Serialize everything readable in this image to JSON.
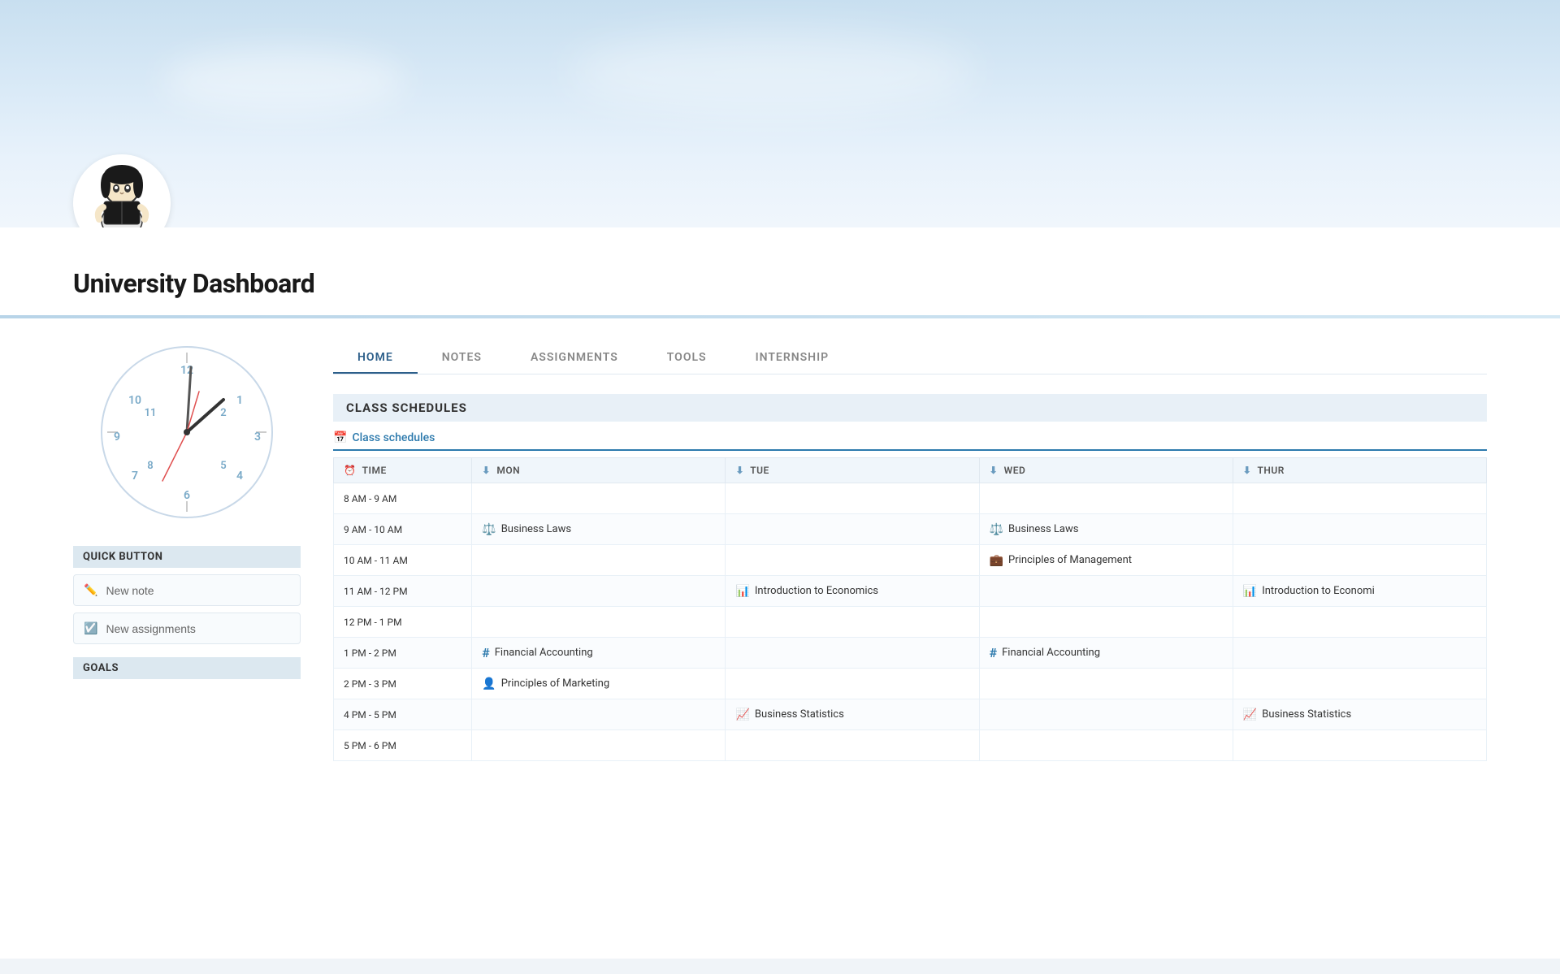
{
  "hero": {
    "title": "University Dashboard"
  },
  "sidebar": {
    "quick_button_label": "QUICK BUTTON",
    "new_note_label": "New note",
    "new_assignments_label": "New assignments",
    "goals_label": "GOALS"
  },
  "nav": {
    "tabs": [
      {
        "id": "home",
        "label": "HOME",
        "active": true
      },
      {
        "id": "notes",
        "label": "NOTES",
        "active": false
      },
      {
        "id": "assignments",
        "label": "ASSIGNMENTS",
        "active": false
      },
      {
        "id": "tools",
        "label": "TOOLS",
        "active": false
      },
      {
        "id": "internship",
        "label": "INTERNSHIP",
        "active": false
      }
    ]
  },
  "schedule": {
    "section_title": "CLASS SCHEDULES",
    "tab_label": "Class schedules",
    "columns": {
      "time": "TIME",
      "mon": "MON",
      "tue": "TUE",
      "wed": "WED",
      "thur": "THUR"
    },
    "rows": [
      {
        "time": "8 AM - 9 AM",
        "mon": null,
        "tue": null,
        "wed": null,
        "thur": null
      },
      {
        "time": "9 AM - 10 AM",
        "mon": {
          "icon": "⚖️",
          "text": "Business Laws",
          "icon_class": "icon-blue"
        },
        "tue": null,
        "wed": {
          "icon": "⚖️",
          "text": "Business Laws",
          "icon_class": "icon-blue"
        },
        "thur": null
      },
      {
        "time": "10 AM - 11 AM",
        "mon": null,
        "tue": null,
        "wed": {
          "icon": "💼",
          "text": "Principles of Management",
          "icon_class": "icon-blue"
        },
        "thur": null
      },
      {
        "time": "11 AM - 12 PM",
        "mon": null,
        "tue": {
          "icon": "📊",
          "text": "Introduction to Economics",
          "icon_class": "icon-blue"
        },
        "wed": null,
        "thur": {
          "icon": "📊",
          "text": "Introduction to Economi",
          "icon_class": "icon-blue"
        }
      },
      {
        "time": "12 PM - 1 PM",
        "mon": null,
        "tue": null,
        "wed": null,
        "thur": null
      },
      {
        "time": "1 PM - 2 PM",
        "mon": {
          "icon": "#",
          "text": "Financial Accounting",
          "icon_class": "icon-blue"
        },
        "tue": null,
        "wed": {
          "icon": "#",
          "text": "Financial Accounting",
          "icon_class": "icon-blue"
        },
        "thur": null
      },
      {
        "time": "2 PM - 3 PM",
        "mon": {
          "icon": "👤",
          "text": "Principles of Marketing",
          "icon_class": "icon-blue"
        },
        "tue": null,
        "wed": null,
        "thur": null
      },
      {
        "time": "4 PM - 5 PM",
        "mon": null,
        "tue": {
          "icon": "📈",
          "text": "Business Statistics",
          "icon_class": "icon-blue"
        },
        "wed": null,
        "thur": {
          "icon": "📈",
          "text": "Business Statistics",
          "icon_class": "icon-blue"
        }
      },
      {
        "time": "5 PM - 6 PM",
        "mon": null,
        "tue": null,
        "wed": null,
        "thur": null
      }
    ]
  }
}
